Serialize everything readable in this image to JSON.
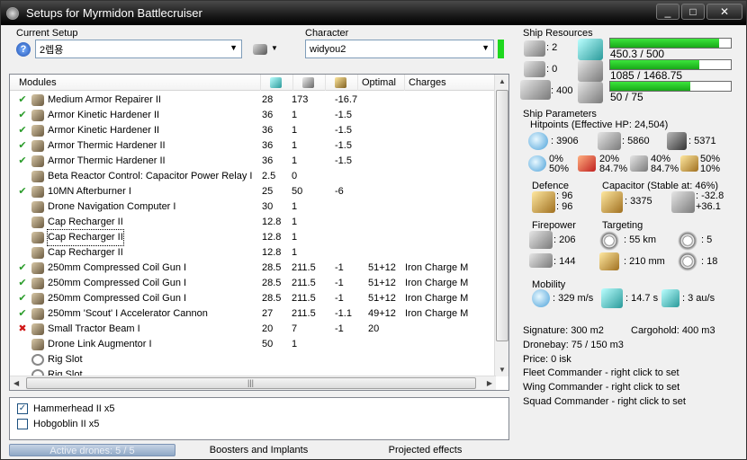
{
  "window": {
    "title": "Setups for Myrmidon Battlecruiser",
    "min": "_",
    "max": "□",
    "close": "✕"
  },
  "setup": {
    "label": "Current Setup",
    "value": "2렙용",
    "help": "?"
  },
  "character": {
    "label": "Character",
    "value": "widyou2"
  },
  "modules": {
    "columns": [
      "Modules",
      "",
      "",
      "",
      "Optimal",
      "Charges"
    ],
    "rows": [
      {
        "state": "✔",
        "icon": "armor-repairer-icon",
        "name": "Medium Armor Repairer II",
        "cpu": "28",
        "pg": "173",
        "cap": "-16.7",
        "optimal": "",
        "charges": ""
      },
      {
        "state": "✔",
        "icon": "hardener-icon",
        "name": "Armor Kinetic Hardener II",
        "cpu": "36",
        "pg": "1",
        "cap": "-1.5",
        "optimal": "",
        "charges": ""
      },
      {
        "state": "✔",
        "icon": "hardener-icon",
        "name": "Armor Kinetic Hardener II",
        "cpu": "36",
        "pg": "1",
        "cap": "-1.5",
        "optimal": "",
        "charges": ""
      },
      {
        "state": "✔",
        "icon": "hardener-icon",
        "name": "Armor Thermic Hardener II",
        "cpu": "36",
        "pg": "1",
        "cap": "-1.5",
        "optimal": "",
        "charges": ""
      },
      {
        "state": "✔",
        "icon": "hardener-icon",
        "name": "Armor Thermic Hardener II",
        "cpu": "36",
        "pg": "1",
        "cap": "-1.5",
        "optimal": "",
        "charges": ""
      },
      {
        "state": "",
        "icon": "capacitor-relay-icon",
        "name": "Beta Reactor Control: Capacitor Power Relay I",
        "cpu": "2.5",
        "pg": "0",
        "cap": "",
        "optimal": "",
        "charges": ""
      },
      {
        "state": "✔",
        "icon": "afterburner-icon",
        "name": "10MN Afterburner I",
        "cpu": "25",
        "pg": "50",
        "cap": "-6",
        "optimal": "",
        "charges": ""
      },
      {
        "state": "",
        "icon": "drone-computer-icon",
        "name": "Drone Navigation Computer I",
        "cpu": "30",
        "pg": "1",
        "cap": "",
        "optimal": "",
        "charges": ""
      },
      {
        "state": "",
        "icon": "cap-recharger-icon",
        "name": "Cap Recharger II",
        "cpu": "12.8",
        "pg": "1",
        "cap": "",
        "optimal": "",
        "charges": ""
      },
      {
        "state": "",
        "icon": "cap-recharger-icon",
        "name": "Cap Recharger II",
        "cpu": "12.8",
        "pg": "1",
        "cap": "",
        "optimal": "",
        "charges": ""
      },
      {
        "state": "",
        "icon": "cap-recharger-icon",
        "name": "Cap Recharger II",
        "cpu": "12.8",
        "pg": "1",
        "cap": "",
        "optimal": "",
        "charges": ""
      },
      {
        "state": "✔",
        "icon": "railgun-icon",
        "name": "250mm Compressed Coil Gun I",
        "cpu": "28.5",
        "pg": "211.5",
        "cap": "-1",
        "optimal": "51+12",
        "charges": "Iron Charge M"
      },
      {
        "state": "✔",
        "icon": "railgun-icon",
        "name": "250mm Compressed Coil Gun I",
        "cpu": "28.5",
        "pg": "211.5",
        "cap": "-1",
        "optimal": "51+12",
        "charges": "Iron Charge M"
      },
      {
        "state": "✔",
        "icon": "railgun-icon",
        "name": "250mm Compressed Coil Gun I",
        "cpu": "28.5",
        "pg": "211.5",
        "cap": "-1",
        "optimal": "51+12",
        "charges": "Iron Charge M"
      },
      {
        "state": "✔",
        "icon": "railgun-icon",
        "name": "250mm 'Scout' I Accelerator Cannon",
        "cpu": "27",
        "pg": "211.5",
        "cap": "-1.1",
        "optimal": "49+12",
        "charges": "Iron Charge M"
      },
      {
        "state": "✖",
        "icon": "tractor-beam-icon",
        "name": "Small Tractor Beam I",
        "cpu": "20",
        "pg": "7",
        "cap": "-1",
        "optimal": "20",
        "charges": ""
      },
      {
        "state": "",
        "icon": "drone-link-icon",
        "name": "Drone Link Augmentor I",
        "cpu": "50",
        "pg": "1",
        "cap": "",
        "optimal": "",
        "charges": ""
      },
      {
        "state": "",
        "icon": "rig-slot-icon",
        "name": "Rig Slot",
        "cpu": "",
        "pg": "",
        "cap": "",
        "optimal": "",
        "charges": ""
      },
      {
        "state": "",
        "icon": "rig-slot-icon",
        "name": "Rig Slot",
        "cpu": "",
        "pg": "",
        "cap": "",
        "optimal": "",
        "charges": ""
      }
    ]
  },
  "drones": [
    {
      "checked": true,
      "mark": "✓",
      "name": "Hammerhead II x5"
    },
    {
      "checked": false,
      "mark": "",
      "name": "Hobgoblin II x5"
    }
  ],
  "tabs": {
    "active_drones": "Active drones: 5 / 5",
    "boosters": "Boosters and Implants",
    "projected": "Projected effects"
  },
  "resources": {
    "title": "Ship Resources",
    "turret_slots": ": 2",
    "launcher_slots": ": 0",
    "drone_bandwidth": ": 400",
    "cpu": {
      "text": "450.3 / 500",
      "fraction": 0.9
    },
    "powergrid": {
      "text": "1085 / 1468.75",
      "fraction": 0.739
    },
    "calibration": {
      "text": "50 / 75",
      "fraction": 0.667
    }
  },
  "params": {
    "title": "Ship Parameters",
    "hitpoints": "Hitpoints (Effective HP: 24,504)",
    "shield_hp": ": 3906",
    "armor_hp": ": 5860",
    "structure_hp": ": 5371",
    "resists": [
      {
        "icon": "em-resist-icon",
        "top": "0%",
        "bottom": "50%"
      },
      {
        "icon": "thermal-resist-icon",
        "top": "20%",
        "bottom": "84.7%"
      },
      {
        "icon": "kinetic-resist-icon",
        "top": "40%",
        "bottom": "84.7%"
      },
      {
        "icon": "explosive-resist-icon",
        "top": "50%",
        "bottom": "10%"
      }
    ],
    "defence_label": "Defence",
    "defence_top": ": 96",
    "defence_bottom": ": 96",
    "capacitor_label": "Capacitor (Stable at: 46%)",
    "capacitor_amount": ": 3375",
    "capacitor_top": ": -32.8",
    "capacitor_bottom": "+36.1",
    "firepower_label": "Firepower",
    "targeting_label": "Targeting",
    "dps": ": 206",
    "volley": ": 144",
    "target_range": ": 55 km",
    "max_targets": ": 5",
    "scan_range": ": 210 mm",
    "scan_res": ": 18",
    "mobility_label": "Mobility",
    "speed": ": 329 m/s",
    "align": ": 14.7 s",
    "warp": ": 3 au/s",
    "signature": "Signature: 300 m2",
    "cargohold": "Cargohold: 400 m3",
    "dronebay": "Dronebay: 75 / 150 m3",
    "price": "Price: 0 isk",
    "fleet_cmd": "Fleet Commander - right click to set",
    "wing_cmd": "Wing Commander - right click to set",
    "squad_cmd": "Squad Commander - right click to set"
  }
}
